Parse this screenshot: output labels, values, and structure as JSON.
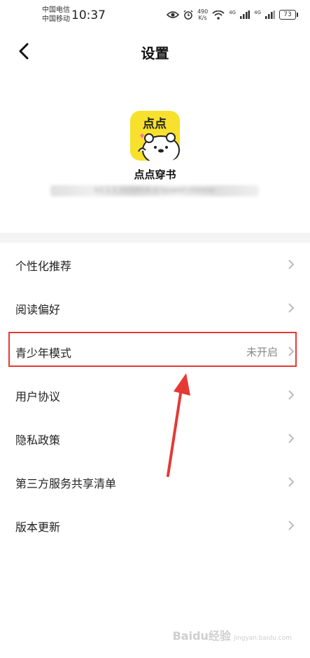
{
  "status_bar": {
    "carrier_1": "中国电信",
    "carrier_2": "中国移动",
    "time": "10:37",
    "net_speed_value": "490",
    "net_speed_unit": "K/s",
    "signal_1": "4G",
    "signal_2": "4G",
    "battery": "73"
  },
  "header": {
    "title": "设置"
  },
  "app": {
    "icon_text": "点点",
    "name": "点点穿书",
    "version": "V2.1.1.2020018.zJ.hJuwml.chinese"
  },
  "menu": {
    "items": [
      {
        "label": "个性化推荐",
        "value": ""
      },
      {
        "label": "阅读偏好",
        "value": ""
      },
      {
        "label": "青少年模式",
        "value": "未开启"
      },
      {
        "label": "用户协议",
        "value": ""
      },
      {
        "label": "隐私政策",
        "value": ""
      },
      {
        "label": "第三方服务共享清单",
        "value": ""
      },
      {
        "label": "版本更新",
        "value": ""
      }
    ]
  },
  "annotation": {
    "highlight_color": "#e53935"
  },
  "watermark": {
    "text": "Baidu经验",
    "sub": "jingyan.baidu.com"
  }
}
